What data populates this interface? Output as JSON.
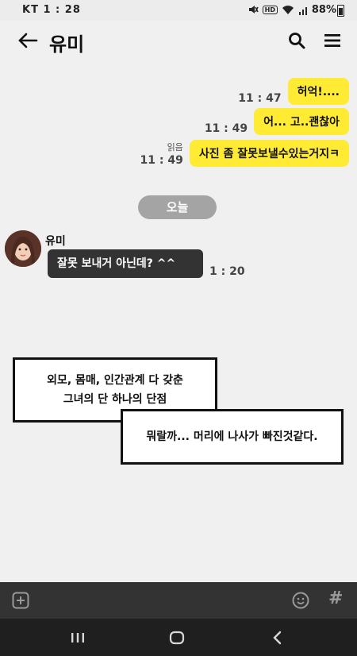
{
  "status_bar": {
    "carrier": "KT",
    "time": "1 : 28",
    "battery": "88%",
    "hd_label": "HD"
  },
  "header": {
    "title": "유미"
  },
  "messages_sent": [
    {
      "text": "허억!....",
      "time": "11 : 47",
      "read": ""
    },
    {
      "text": "어... 고..괜찮아",
      "time": "11 : 49",
      "read": ""
    },
    {
      "text": "사진 좀 잘못보낼수있는거지ㅋ",
      "time": "11 : 49",
      "read": "읽음"
    }
  ],
  "date_divider": "오늘",
  "received": {
    "sender": "유미",
    "text": "잘못 보내거 아닌데? ^^",
    "time": "1 : 20"
  },
  "captions": {
    "line1": "외모, 몸매, 인간관계 다 갖춘",
    "line2": "그녀의 단 하나의 단점",
    "line3": "뭐랄까... 머리에 나사가 빠진것같다."
  },
  "input_bar": {
    "hash": "#"
  },
  "colors": {
    "my_bubble": "#ffeb33",
    "other_bubble": "#333333",
    "background": "#f0f0f0"
  }
}
